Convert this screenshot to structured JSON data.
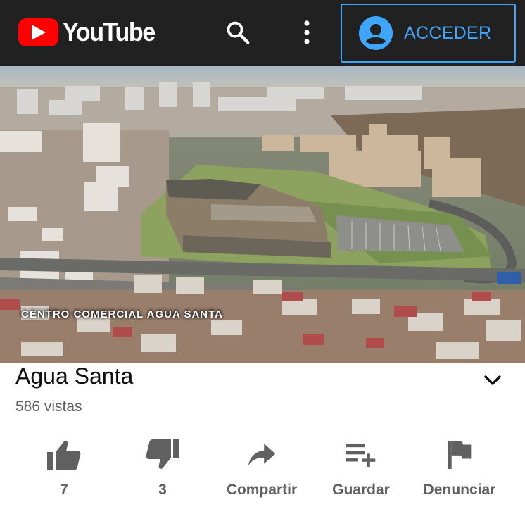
{
  "header": {
    "logo_text": "YouTube",
    "signin_label": "ACCEDER",
    "icons": [
      "youtube-play-icon",
      "search-icon",
      "more-vert-icon",
      "account-circle-icon"
    ],
    "accent_color": "#3ea6ff",
    "brand_color": "#ff0000"
  },
  "video": {
    "overlay_caption": "CENTRO COMERCIAL AGUA SANTA"
  },
  "info": {
    "title": "Agua Santa",
    "views": "586 vistas"
  },
  "actions": [
    {
      "icon": "thumb-up-icon",
      "label": "7"
    },
    {
      "icon": "thumb-down-icon",
      "label": "3"
    },
    {
      "icon": "share-icon",
      "label": "Compartir"
    },
    {
      "icon": "playlist-add-icon",
      "label": "Guardar"
    },
    {
      "icon": "flag-icon",
      "label": "Denunciar"
    }
  ]
}
